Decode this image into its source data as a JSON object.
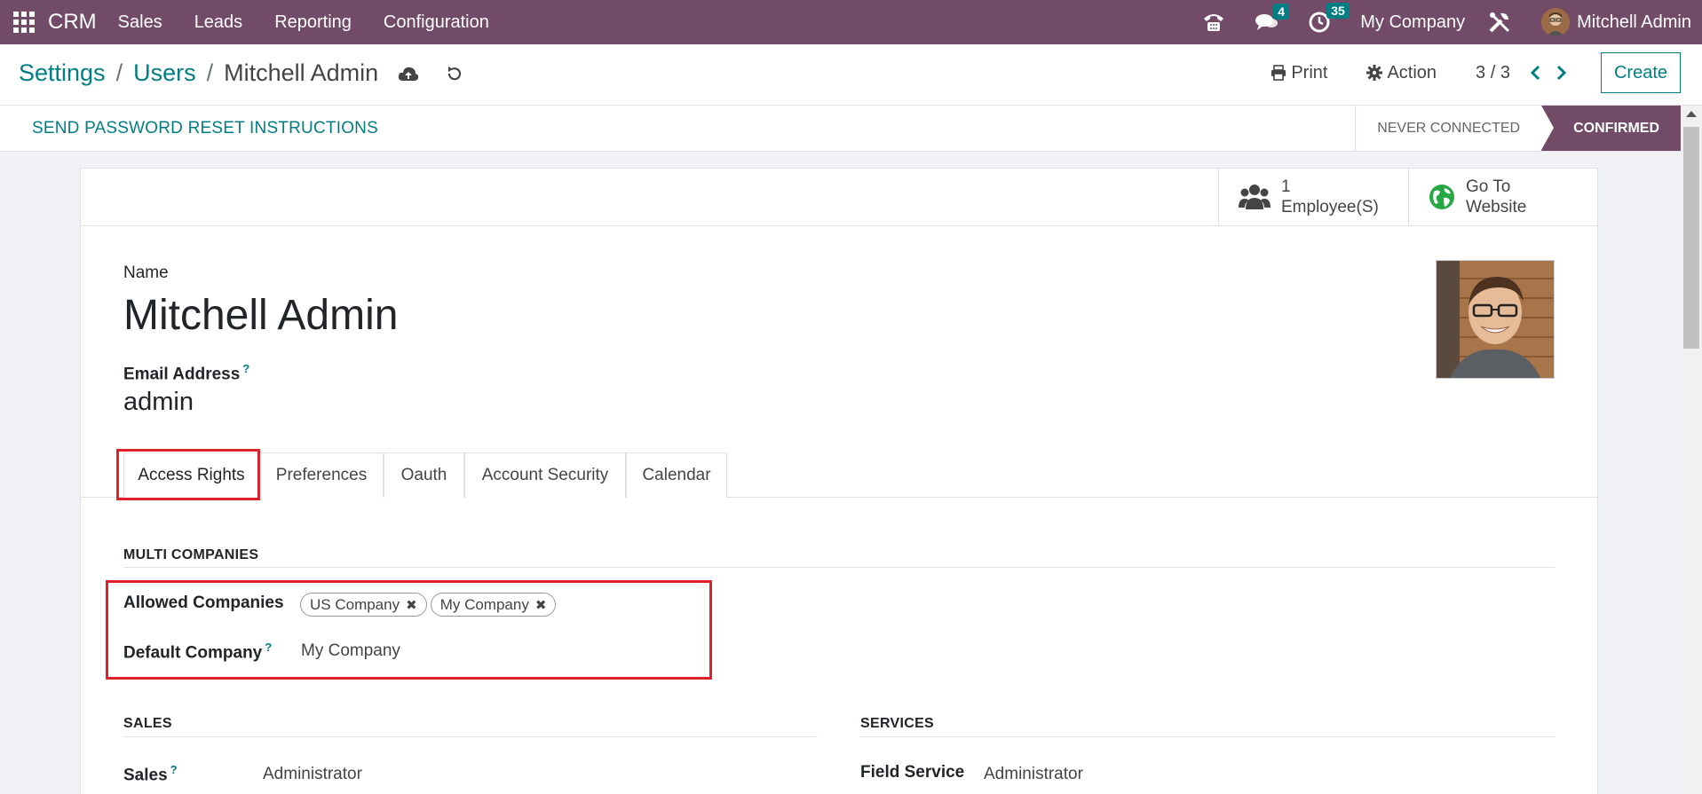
{
  "navbar": {
    "brand": "CRM",
    "menus": [
      "Sales",
      "Leads",
      "Reporting",
      "Configuration"
    ],
    "messages_badge": "4",
    "activities_badge": "35",
    "company": "My Company",
    "user": "Mitchell Admin"
  },
  "breadcrumb": {
    "items": [
      "Settings",
      "Users"
    ],
    "current": "Mitchell Admin"
  },
  "controls": {
    "print_label": "Print",
    "action_label": "Action",
    "pager": "3 / 3",
    "create_label": "Create"
  },
  "statusbar": {
    "reset_label": "SEND PASSWORD RESET INSTRUCTIONS",
    "steps": [
      "NEVER CONNECTED",
      "CONFIRMED"
    ],
    "active_step": "CONFIRMED"
  },
  "smart_buttons": {
    "employees_count": "1",
    "employees_label": "Employee(S)",
    "website_line1": "Go To",
    "website_line2": "Website"
  },
  "form": {
    "name_label": "Name",
    "name_value": "Mitchell Admin",
    "email_label": "Email Address",
    "email_help": "?",
    "email_value": "admin"
  },
  "tabs": [
    "Access Rights",
    "Preferences",
    "Oauth",
    "Account Security",
    "Calendar"
  ],
  "multi_companies": {
    "title": "MULTI COMPANIES",
    "allowed_label": "Allowed Companies",
    "allowed_tags": [
      "US Company",
      "My Company"
    ],
    "default_label": "Default Company",
    "default_help": "?",
    "default_value": "My Company"
  },
  "sales_section": {
    "title": "SALES",
    "field_label": "Sales",
    "field_help": "?",
    "field_value": "Administrator"
  },
  "services_section": {
    "title": "SERVICES",
    "field_label": "Field Service",
    "field_value": "Administrator"
  },
  "colors": {
    "brand": "#714b67",
    "accent": "#017e84",
    "highlight": "#e0202c"
  }
}
